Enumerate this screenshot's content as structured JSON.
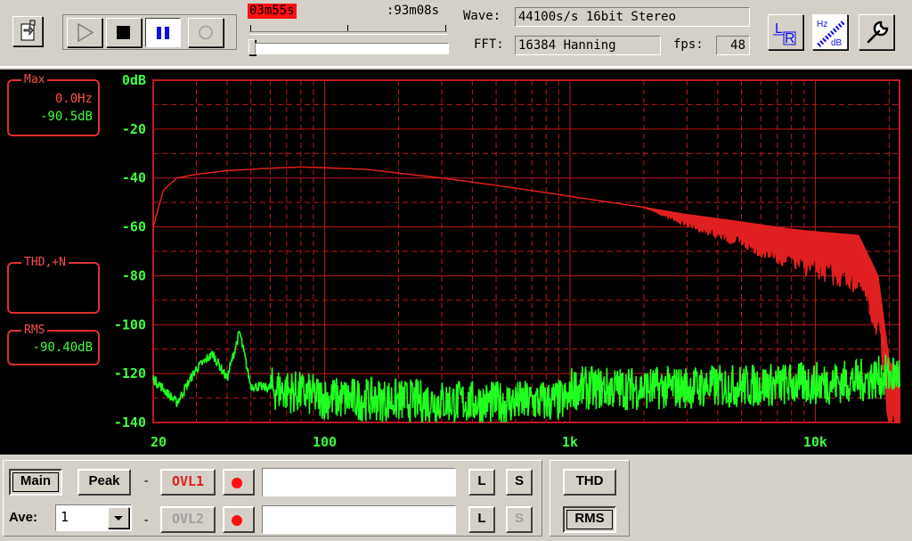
{
  "toolbar": {
    "time_elapsed": "03m55s",
    "time_total": ":93m08s",
    "wave_label": "Wave:",
    "wave_value": "44100s/s 16bit Stereo",
    "fft_label": "FFT:",
    "fft_value": "16384 Hanning",
    "fps_label": "fps:",
    "fps_value": "48",
    "lr_label": "LR",
    "hz_label": "Hz",
    "db_label": "dB"
  },
  "panels": {
    "max": {
      "title": "Max",
      "freq": "0.0Hz",
      "level": "-90.5dB"
    },
    "thd": {
      "title": "THD,+N",
      "value": ""
    },
    "rms": {
      "title": "RMS",
      "value": "-90.40dB"
    }
  },
  "bottom": {
    "main_label": "Main",
    "peak_label": "Peak",
    "ave_label": "Ave:",
    "ave_value": "1",
    "dash": "-",
    "ovl1_label": "OVL1",
    "ovl2_label": "OVL2",
    "l_label": "L",
    "s_label": "S",
    "thd_label": "THD",
    "rms_label": "RMS",
    "field1_value": "",
    "field2_value": ""
  },
  "colors": {
    "grid": "#c01818",
    "red_trace": "#e02020",
    "green_trace": "#20ff20",
    "text_red": "#ff5050",
    "text_green": "#40ff40"
  },
  "chart_data": {
    "type": "line",
    "xscale": "log",
    "xlim": [
      20,
      22050
    ],
    "ylim": [
      -140,
      0
    ],
    "yticks": [
      "0dB",
      "-20",
      "-40",
      "-60",
      "-80",
      "-100",
      "-120",
      "-140"
    ],
    "xticks": [
      "20",
      "100",
      "1k",
      "10k"
    ],
    "grid": true,
    "series": [
      {
        "color": "red",
        "points": [
          [
            20,
            -60
          ],
          [
            22,
            -45
          ],
          [
            25,
            -40
          ],
          [
            30,
            -38.5
          ],
          [
            40,
            -37
          ],
          [
            60,
            -36
          ],
          [
            80,
            -35.5
          ],
          [
            100,
            -35.8
          ],
          [
            150,
            -36.5
          ],
          [
            200,
            -38
          ],
          [
            300,
            -40
          ],
          [
            500,
            -43
          ],
          [
            800,
            -46
          ],
          [
            1000,
            -47.5
          ],
          [
            2000,
            -52
          ],
          [
            3000,
            -55
          ],
          [
            5000,
            -58
          ],
          [
            8000,
            -61
          ],
          [
            10000,
            -62
          ],
          [
            15000,
            -63.5
          ],
          [
            18000,
            -80
          ],
          [
            20000,
            -115
          ],
          [
            22050,
            -120
          ]
        ]
      },
      {
        "color": "green",
        "points": [
          [
            20,
            -122
          ],
          [
            25,
            -132
          ],
          [
            30,
            -118
          ],
          [
            35,
            -112
          ],
          [
            40,
            -122
          ],
          [
            45,
            -103
          ],
          [
            50,
            -125
          ],
          [
            60,
            -126
          ],
          [
            80,
            -128
          ],
          [
            100,
            -130
          ],
          [
            200,
            -131
          ],
          [
            500,
            -132
          ],
          [
            1000,
            -131
          ],
          [
            2000,
            -131
          ],
          [
            5000,
            -130
          ],
          [
            10000,
            -129
          ],
          [
            15000,
            -128
          ],
          [
            20000,
            -126
          ],
          [
            22050,
            -125
          ]
        ]
      }
    ]
  }
}
